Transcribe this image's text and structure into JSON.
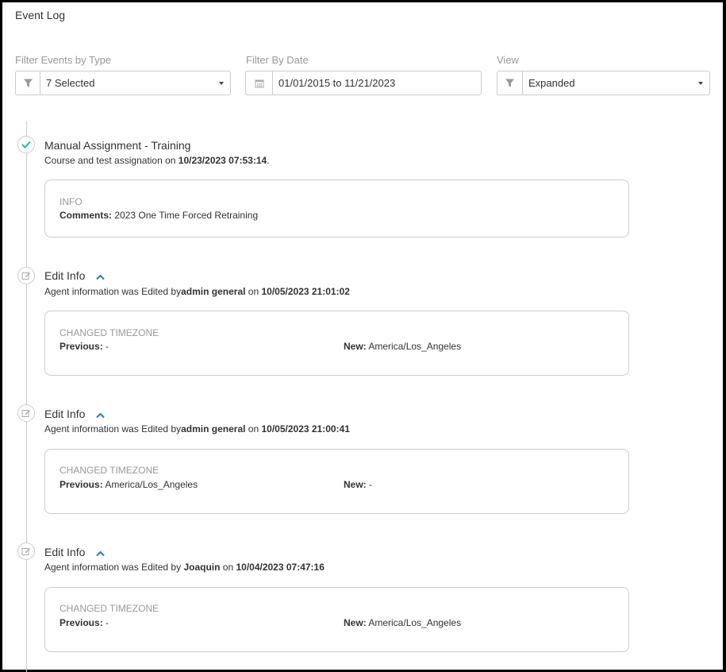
{
  "page": {
    "title": "Event Log"
  },
  "filters": {
    "type": {
      "label": "Filter Events by Type",
      "value": "7 Selected",
      "icon": "filter-icon"
    },
    "date": {
      "label": "Filter By Date",
      "value": "01/01/2015 to 11/21/2023",
      "icon": "calendar-icon"
    },
    "view": {
      "label": "View",
      "value": "Expanded",
      "icon": "filter-icon"
    }
  },
  "colors": {
    "accent_teal": "#2bb5a6",
    "chevron_blue": "#2a79b8",
    "border": "#cccccc"
  },
  "events": [
    {
      "icon": "check-icon",
      "title": "Manual Assignment - Training",
      "desc_prefix": "Course and test assignation on ",
      "desc_date": "10/23/2023 07:53:14",
      "desc_suffix": ".",
      "card": {
        "heading": "INFO",
        "comments_label": "Comments:",
        "comments_value": "2023 One Time Forced Retraining"
      }
    },
    {
      "icon": "edit-icon",
      "title": "Edit Info",
      "desc_prefix": "Agent information was Edited by",
      "desc_user": "admin general",
      "desc_on": " on ",
      "desc_date": "10/05/2023 21:01:02",
      "card": {
        "heading": "CHANGED TIMEZONE",
        "previous_label": "Previous:",
        "previous_value": "-",
        "new_label": "New:",
        "new_value": "America/Los_Angeles"
      }
    },
    {
      "icon": "edit-icon",
      "title": "Edit Info",
      "desc_prefix": "Agent information was Edited by",
      "desc_user": "admin general",
      "desc_on": " on ",
      "desc_date": "10/05/2023 21:00:41",
      "card": {
        "heading": "CHANGED TIMEZONE",
        "previous_label": "Previous:",
        "previous_value": "America/Los_Angeles",
        "new_label": "New:",
        "new_value": "-"
      }
    },
    {
      "icon": "edit-icon",
      "title": "Edit Info",
      "desc_prefix": "Agent information was Edited by ",
      "desc_user": "Joaquin",
      "desc_on": " on ",
      "desc_date": "10/04/2023 07:47:16",
      "card": {
        "heading": "CHANGED TIMEZONE",
        "previous_label": "Previous:",
        "previous_value": "-",
        "new_label": "New:",
        "new_value": "America/Los_Angeles"
      }
    }
  ]
}
